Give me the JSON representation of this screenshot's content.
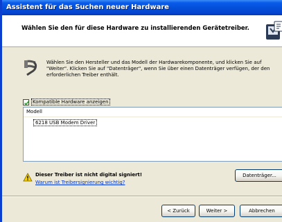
{
  "window": {
    "title": "Assistent für das Suchen neuer Hardware"
  },
  "header": {
    "title": "Wählen Sie den für diese Hardware zu installierenden Gerätetreiber."
  },
  "intro": {
    "text": "Wählen Sie den Hersteller und das Modell der Hardwarekomponente, und klicken Sie auf \"Weiter\". Klicken Sie auf \"Datenträger\", wenn Sie über einen Datenträger verfügen, der den erforderlichen Treiber enthält."
  },
  "compatible": {
    "label": "Kompatible Hardware anzeigen",
    "checked": true
  },
  "model_list": {
    "header": "Modell",
    "items": [
      "6218 USB Modem Driver"
    ]
  },
  "warning": {
    "title": "Dieser Treiber ist nicht digital signiert!",
    "link": "Warum ist Treibersignierung wichtig?"
  },
  "buttons": {
    "disk": "Datenträger...",
    "back": "< Zurück",
    "next": "Weiter >",
    "cancel": "Abbrechen"
  },
  "colors": {
    "titlebar": "#0450d9",
    "dialog_bg": "#ece9d8",
    "link": "#0033cc"
  }
}
